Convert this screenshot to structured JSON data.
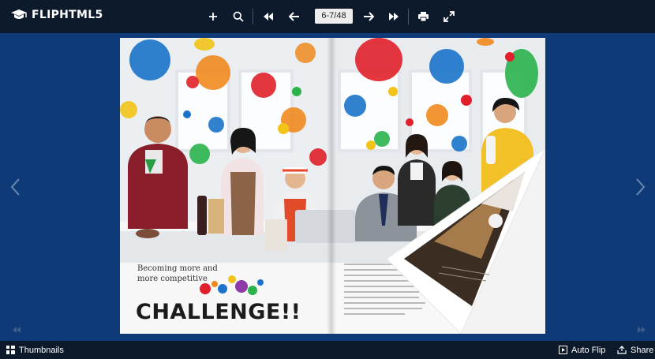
{
  "toolbar": {
    "brand": "FLIPHTML5",
    "page_indicator": "6-7/48"
  },
  "book": {
    "left_page": {
      "subtitle_line1": "Becoming more and",
      "subtitle_line2": "more competitive",
      "headline": "CHALLENGE!!"
    }
  },
  "bottombar": {
    "thumbnails_label": "Thumbnails",
    "autoflip_label": "Auto Flip",
    "share_label": "Share"
  },
  "colors": {
    "toolbar_bg": "#0d1a2b",
    "stage_bg": "#0e3a78",
    "dot_blue": "#1a73c9",
    "dot_red": "#e0202a",
    "dot_orange": "#ef8a1f",
    "dot_yellow": "#f2c318",
    "dot_green": "#2bb24c"
  }
}
